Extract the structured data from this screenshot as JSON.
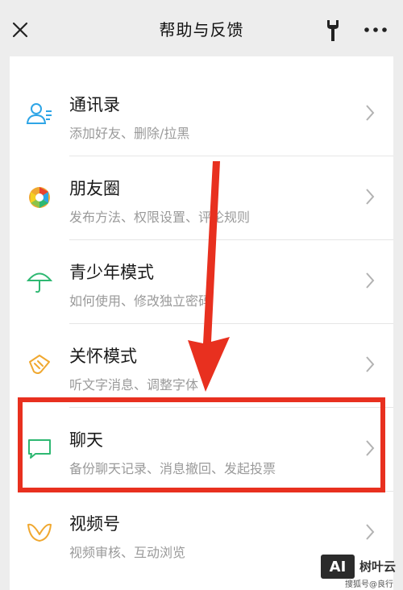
{
  "header": {
    "title": "帮助与反馈"
  },
  "items": [
    {
      "name": "通讯录",
      "desc": "添加好友、删除/拉黑",
      "icon": "contacts-icon",
      "color": "#1aad19"
    },
    {
      "name": "朋友圈",
      "desc": "发布方法、权限设置、评论规则",
      "icon": "moments-icon",
      "color": "#f5a623"
    },
    {
      "name": "青少年模式",
      "desc": "如何使用、修改独立密码",
      "icon": "umbrella-icon",
      "color": "#2eb872"
    },
    {
      "name": "关怀模式",
      "desc": "听文字消息、调整字体",
      "icon": "care-hand-icon",
      "color": "#f0a830"
    },
    {
      "name": "聊天",
      "desc": "备份聊天记录、消息撤回、发起投票",
      "icon": "chat-bubble-icon",
      "color": "#2eb872"
    },
    {
      "name": "视频号",
      "desc": "视频审核、互动浏览",
      "icon": "channels-icon",
      "color": "#f0a830"
    }
  ],
  "watermark": {
    "logo": "AI",
    "brand": "树叶云",
    "sub": "搜狐号@良行"
  },
  "colors": {
    "highlight": "#e8301f",
    "background": "#ededed"
  }
}
